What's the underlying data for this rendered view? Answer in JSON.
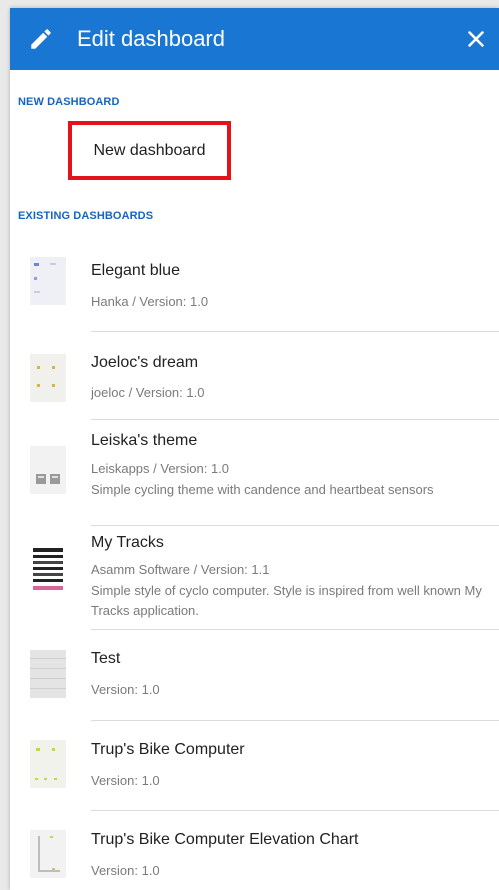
{
  "header": {
    "title": "Edit dashboard",
    "edit_icon": "pencil-icon",
    "close_icon": "close-icon",
    "color": "#1976d2"
  },
  "new_section": {
    "label": "NEW DASHBOARD",
    "item_label": "New dashboard",
    "highlight_color": "#e3131b"
  },
  "existing_section": {
    "label": "EXISTING DASHBOARDS",
    "items": [
      {
        "name": "Elegant blue",
        "meta": "Hanka / Version: 1.0",
        "description": ""
      },
      {
        "name": "Joeloc's dream",
        "meta": "joeloc / Version: 1.0",
        "description": ""
      },
      {
        "name": "Leiska's theme",
        "meta": "Leiskapps / Version: 1.0",
        "description": "Simple cycling theme with candence and heartbeat sensors"
      },
      {
        "name": "My Tracks",
        "meta": "Asamm Software / Version: 1.1",
        "description": "Simple style of cyclo computer. Style is inspired from well known My Tracks application."
      },
      {
        "name": "Test",
        "meta": "Version: 1.0",
        "description": ""
      },
      {
        "name": "Trup's Bike Computer",
        "meta": "Version: 1.0",
        "description": ""
      },
      {
        "name": "Trup's Bike Computer Elevation Chart",
        "meta": "Version: 1.0",
        "description": ""
      }
    ]
  }
}
